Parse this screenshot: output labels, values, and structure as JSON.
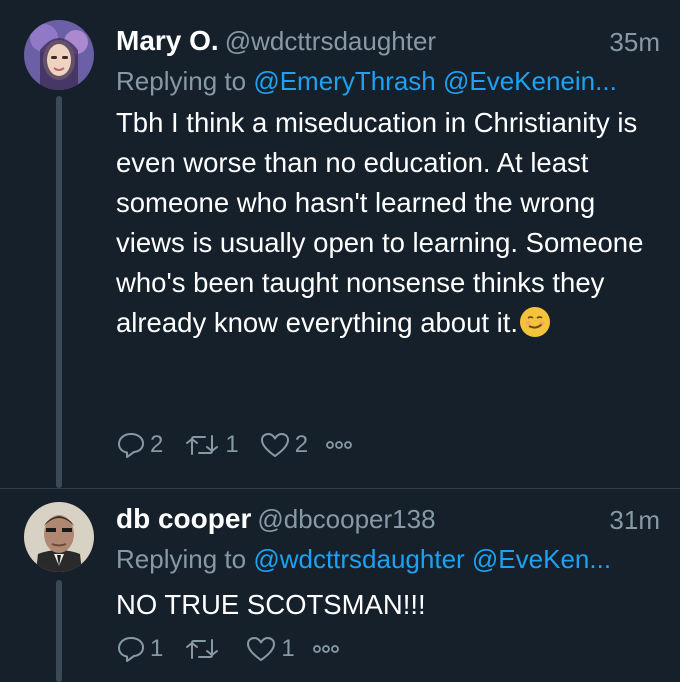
{
  "tweets": [
    {
      "name": "Mary O.",
      "handle": "@wdcttrsdaughter",
      "time": "35m",
      "replying_prefix": "Replying to ",
      "replying_mentions": "@EmeryThrash @EveKenein...",
      "text": "Tbh I think a miseducation in Christianity is even worse than no education. At least someone who hasn't learned the wrong views is usually open to learning. Someone who's been taught nonsense thinks they already know everything about it.",
      "emoji": "smirking-face-emoji",
      "replies": "2",
      "retweets": "1",
      "likes": "2"
    },
    {
      "name": "db cooper",
      "handle": "@dbcooper138",
      "time": "31m",
      "replying_prefix": "Replying to ",
      "replying_mentions": "@wdcttrsdaughter @EveKen...",
      "text": "NO TRUE SCOTSMAN!!!",
      "replies": "1",
      "retweets": "",
      "likes": "1"
    }
  ],
  "colors": {
    "background": "#15202b",
    "secondary_text": "#8899a6",
    "link": "#1da1f2",
    "thread_line": "#3c4a58"
  }
}
